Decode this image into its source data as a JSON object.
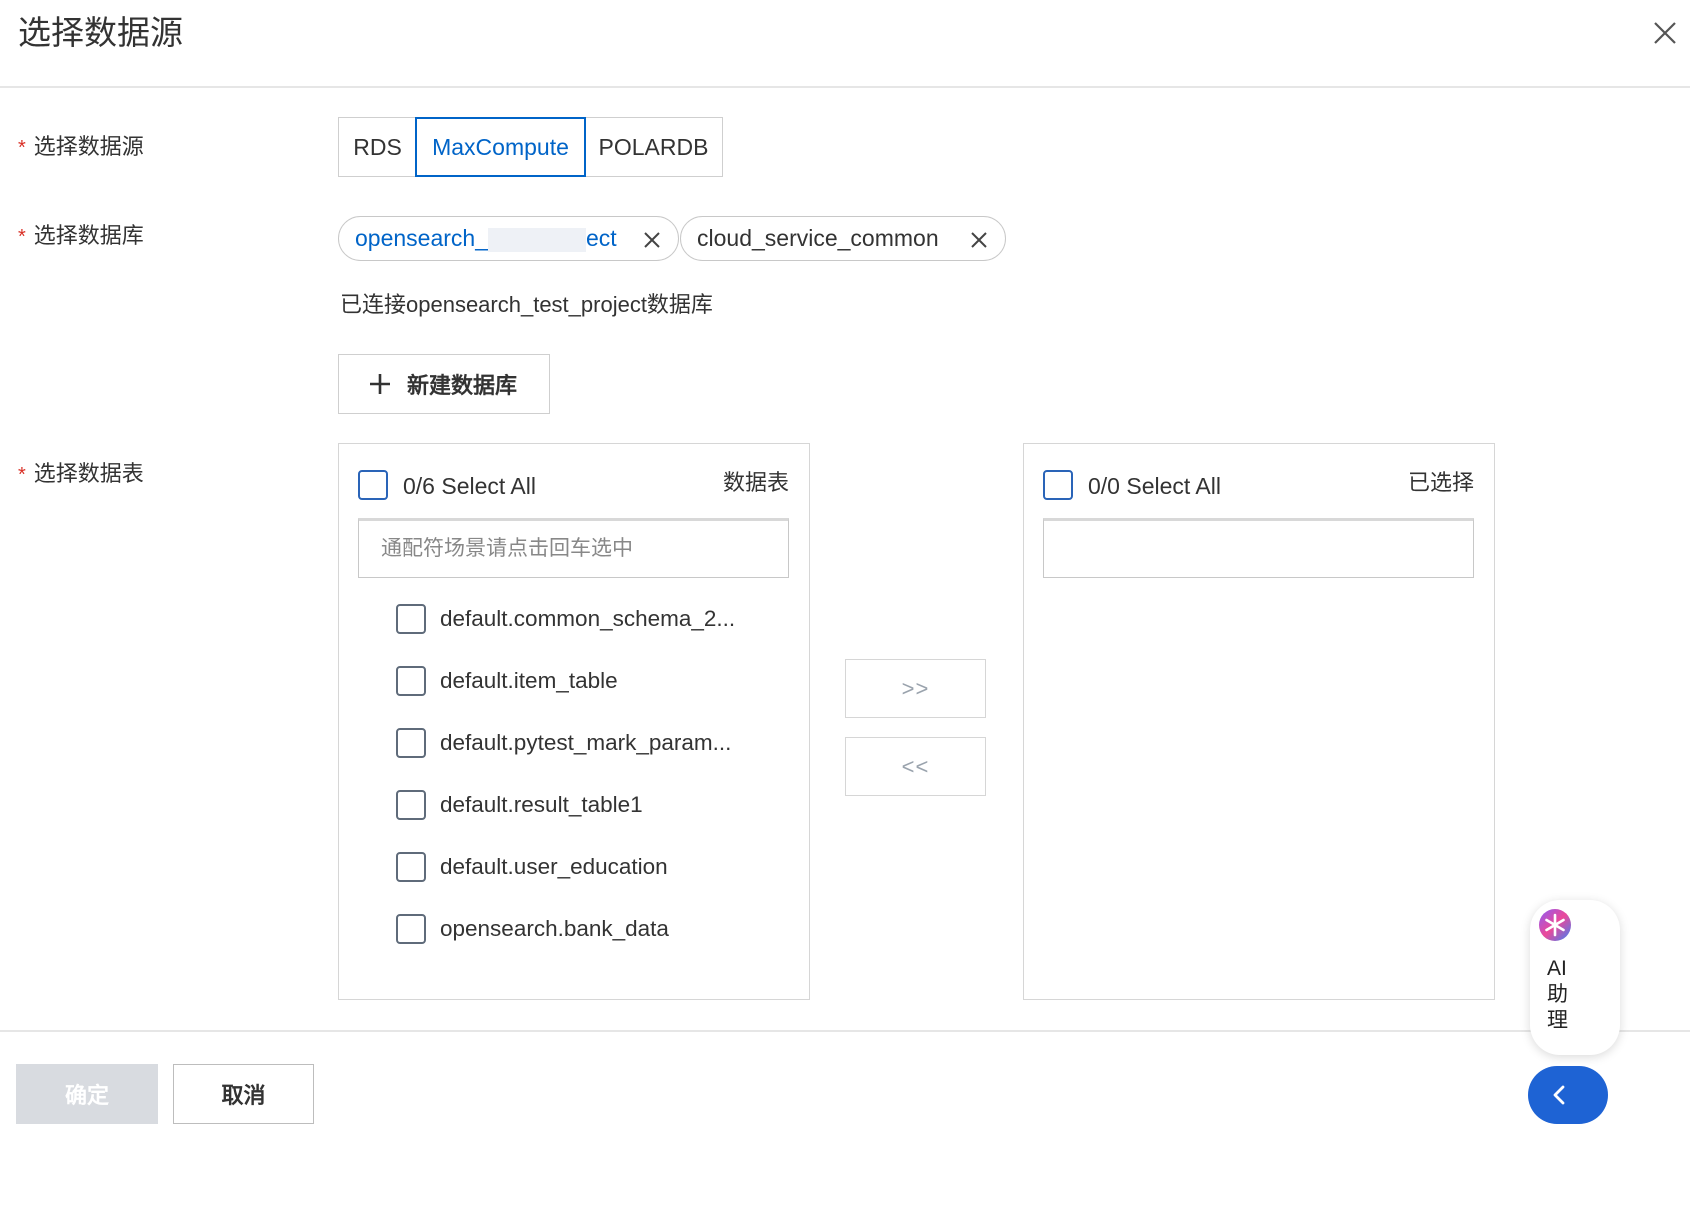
{
  "dialog": {
    "title": "选择数据源",
    "close_icon": "close-icon"
  },
  "form": {
    "datasource": {
      "label": "选择数据源",
      "required_mark": "*",
      "options": [
        "RDS",
        "MaxCompute",
        "POLARDB"
      ],
      "selected": "MaxCompute"
    },
    "database": {
      "label": "选择数据库",
      "required_mark": "*",
      "tags": [
        {
          "text_start": "opensearch_",
          "text_end": "ect",
          "redacted": true,
          "primary": true
        },
        {
          "text": "cloud_service_common",
          "primary": false
        }
      ],
      "connected_text": "已连接opensearch_test_project数据库",
      "new_button_label": "新建数据库"
    },
    "table": {
      "label": "选择数据表",
      "required_mark": "*"
    }
  },
  "transfer": {
    "left": {
      "select_all": "0/6 Select All",
      "title": "数据表",
      "search_placeholder": "通配符场景请点击回车选中",
      "items": [
        "default.common_schema_2...",
        "default.item_table",
        "default.pytest_mark_param...",
        "default.result_table1",
        "default.user_education",
        "opensearch.bank_data"
      ]
    },
    "right": {
      "select_all": "0/0 Select All",
      "title": "已选择",
      "search_value": ""
    },
    "move_right_label": ">>",
    "move_left_label": "<<"
  },
  "footer": {
    "ok_label": "确定",
    "cancel_label": "取消"
  },
  "ai_assistant": {
    "label": "AI助理",
    "icon": "ai-assistant-icon",
    "collapse_icon": "chevron-left-icon"
  },
  "colors": {
    "accent": "#0064c8",
    "required": "#d93026",
    "disabled_button": "#d8dbe0",
    "floating_button": "#1e63d4"
  }
}
